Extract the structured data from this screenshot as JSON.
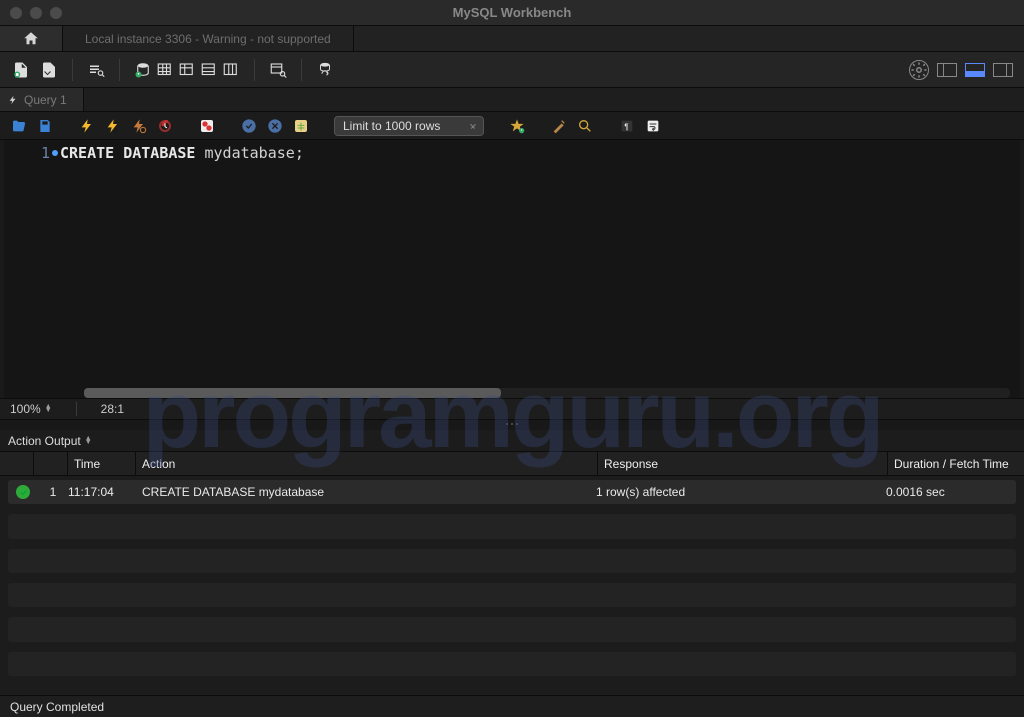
{
  "window_title": "MySQL Workbench",
  "tabs": {
    "connection_label": "Local instance 3306 - Warning - not supported"
  },
  "query_tab_label": "Query 1",
  "limit_dropdown": "Limit to 1000 rows",
  "editor": {
    "line_number": "1",
    "code_keyword1": "CREATE",
    "code_keyword2": "DATABASE",
    "code_ident": "mydatabase",
    "code_semicolon": ";"
  },
  "zoom": "100%",
  "cursor_pos": "28:1",
  "output_mode": "Action Output",
  "columns": {
    "time": "Time",
    "action": "Action",
    "response": "Response",
    "duration": "Duration / Fetch Time"
  },
  "rows": [
    {
      "index": "1",
      "time": "11:17:04",
      "action": "CREATE DATABASE mydatabase",
      "response": "1 row(s) affected",
      "duration": "0.0016 sec"
    }
  ],
  "status_text": "Query Completed",
  "watermark": "programguru.org"
}
